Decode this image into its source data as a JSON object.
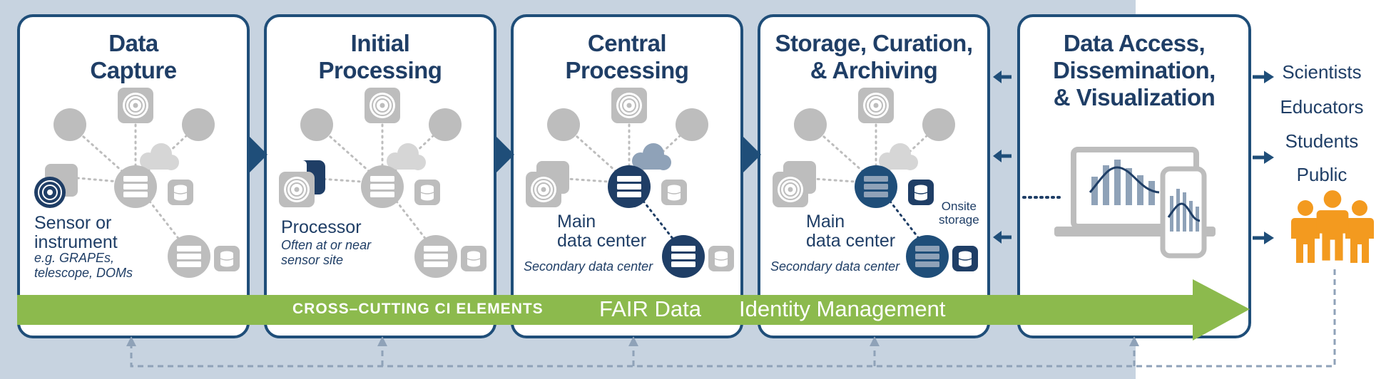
{
  "stages": [
    {
      "title_lines": [
        "Data",
        "Capture"
      ],
      "labels": {
        "sensor_lines": [
          "Sensor or",
          "instrument"
        ],
        "example_lines": [
          "e.g. GRAPEs,",
          "telescope, DOMs"
        ]
      }
    },
    {
      "title_lines": [
        "Initial",
        "Processing"
      ],
      "labels": {
        "processor": "Processor",
        "note_lines": [
          "Often at or near",
          "sensor site"
        ]
      }
    },
    {
      "title_lines": [
        "Central",
        "Processing"
      ],
      "labels": {
        "main_lines": [
          "Main",
          "data center"
        ],
        "secondary": "Secondary data center"
      }
    },
    {
      "title_lines": [
        "Storage, Curation,",
        "& Archiving"
      ],
      "labels": {
        "main_lines": [
          "Main",
          "data center"
        ],
        "onsite_lines": [
          "Onsite",
          "storage"
        ],
        "secondary": "Secondary data center"
      }
    },
    {
      "title_lines": [
        "Data Access,",
        "Dissemination,",
        "& Visualization"
      ]
    }
  ],
  "band": {
    "cross_cutting": "CROSS–CUTTING CI ELEMENTS",
    "items": [
      "FAIR Data",
      "Identity Management"
    ]
  },
  "audience": [
    "Scientists",
    "Educators",
    "Students",
    "Public"
  ],
  "colors": {
    "navy": "#1f3e66",
    "border": "#1f4e79",
    "band_green": "#8cba4d",
    "background": "#c7d3e0",
    "icon_gray": "#bdbdbd",
    "people_orange": "#f39a1f"
  }
}
